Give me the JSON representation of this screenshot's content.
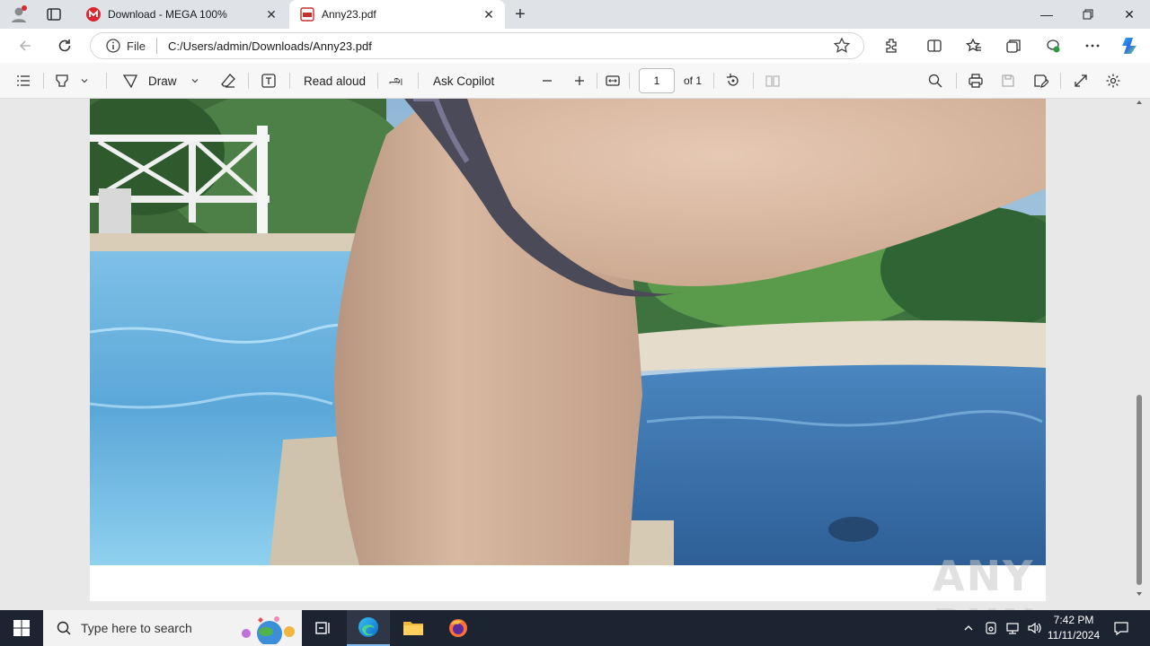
{
  "browser": {
    "tabs": [
      {
        "title": "Download - MEGA 100%",
        "favicon": "mega-icon",
        "active": false
      },
      {
        "title": "Anny23.pdf",
        "favicon": "pdf-icon",
        "active": true
      }
    ],
    "address": {
      "scheme": "File",
      "url": "C:/Users/admin/Downloads/Anny23.pdf"
    }
  },
  "pdf_toolbar": {
    "draw_label": "Draw",
    "read_aloud_label": "Read aloud",
    "ask_copilot_label": "Ask Copilot",
    "page_current": "1",
    "page_total": "of 1"
  },
  "watermark": "ANY RUN",
  "taskbar": {
    "search_placeholder": "Type here to search",
    "time": "7:42 PM",
    "date": "11/11/2024"
  },
  "colors": {
    "accent": "#0f6cbd",
    "taskbar_bg": "#1c2331",
    "mega_red": "#d9272e"
  }
}
